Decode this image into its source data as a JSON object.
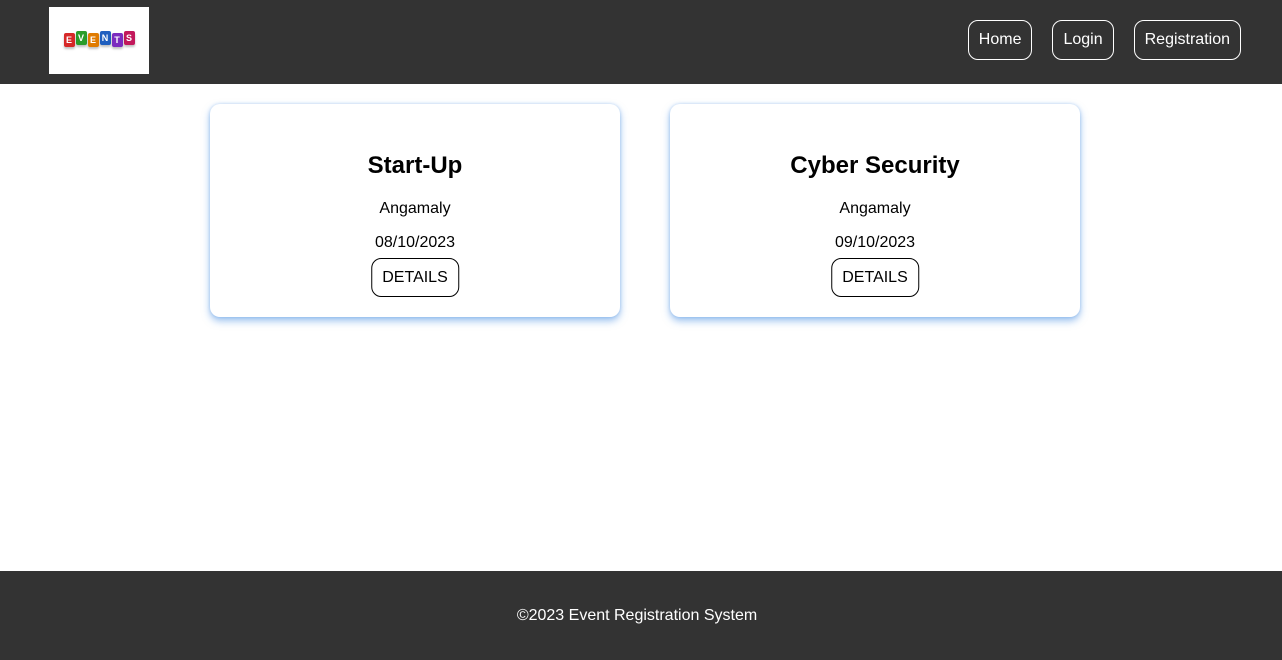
{
  "header": {
    "logo": {
      "letters": [
        "E",
        "V",
        "E",
        "N",
        "T",
        "S"
      ],
      "colors": [
        "#d62828",
        "#2a9d2a",
        "#e07b00",
        "#1f5fbf",
        "#7b2cbf",
        "#c2185b"
      ]
    },
    "nav": {
      "home": "Home",
      "login": "Login",
      "registration": "Registration"
    }
  },
  "events": [
    {
      "title": "Start-Up",
      "location": "Angamaly",
      "date": "08/10/2023",
      "button": "DETAILS"
    },
    {
      "title": "Cyber Security",
      "location": "Angamaly",
      "date": "09/10/2023",
      "button": "DETAILS"
    }
  ],
  "footer": {
    "text": "©2023 Event Registration System"
  },
  "colors": {
    "bar_background": "#333333",
    "card_shadow": "#4a90e2"
  }
}
